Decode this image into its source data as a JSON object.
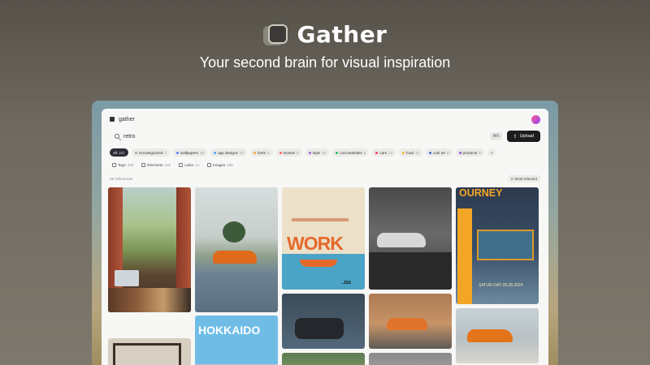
{
  "hero": {
    "brand": "Gather",
    "tagline": "Your second brain for visual inspiration"
  },
  "app": {
    "name": "gather",
    "search": {
      "value": "retro",
      "shortcut": "⌘K"
    },
    "upload_label": "Upload",
    "chips": [
      {
        "label": "All",
        "count": "281",
        "active": true,
        "color": ""
      },
      {
        "label": "Uncategorized",
        "count": "7",
        "color": "#aaaaaa"
      },
      {
        "label": "wallpapers",
        "count": "48",
        "color": "#5b7cfa"
      },
      {
        "label": "app designs",
        "count": "12",
        "color": "#4aa3ff"
      },
      {
        "label": "fonts",
        "count": "5",
        "color": "#ff9f43"
      },
      {
        "label": "movies",
        "count": "6",
        "color": "#ff6b6b"
      },
      {
        "label": "style",
        "count": "15",
        "color": "#a55eea"
      },
      {
        "label": "cool websites",
        "count": "8",
        "color": "#20bf6b"
      },
      {
        "label": "cars",
        "count": "14",
        "color": "#eb3b5a"
      },
      {
        "label": "food",
        "count": "11",
        "color": "#f7b731"
      },
      {
        "label": "cool art",
        "count": "8",
        "color": "#3867d6"
      },
      {
        "label": "products",
        "count": "9",
        "color": "#8854d0"
      }
    ],
    "add_chip": "+",
    "types": [
      {
        "label": "Tags",
        "count": "206"
      },
      {
        "label": "Elements",
        "count": "162"
      },
      {
        "label": "Links",
        "count": "14"
      },
      {
        "label": "Images",
        "count": "286"
      }
    ],
    "ref_count": "28 references",
    "sort_label": "Most relevant",
    "cards": {
      "work_title": "WORK",
      "work_tag": ".JSS",
      "sunset_title": "OURNEY",
      "sunset_date": "SATUR-DAY 09.28.2024",
      "hokkaido_title": "HOKKAIDO"
    }
  }
}
